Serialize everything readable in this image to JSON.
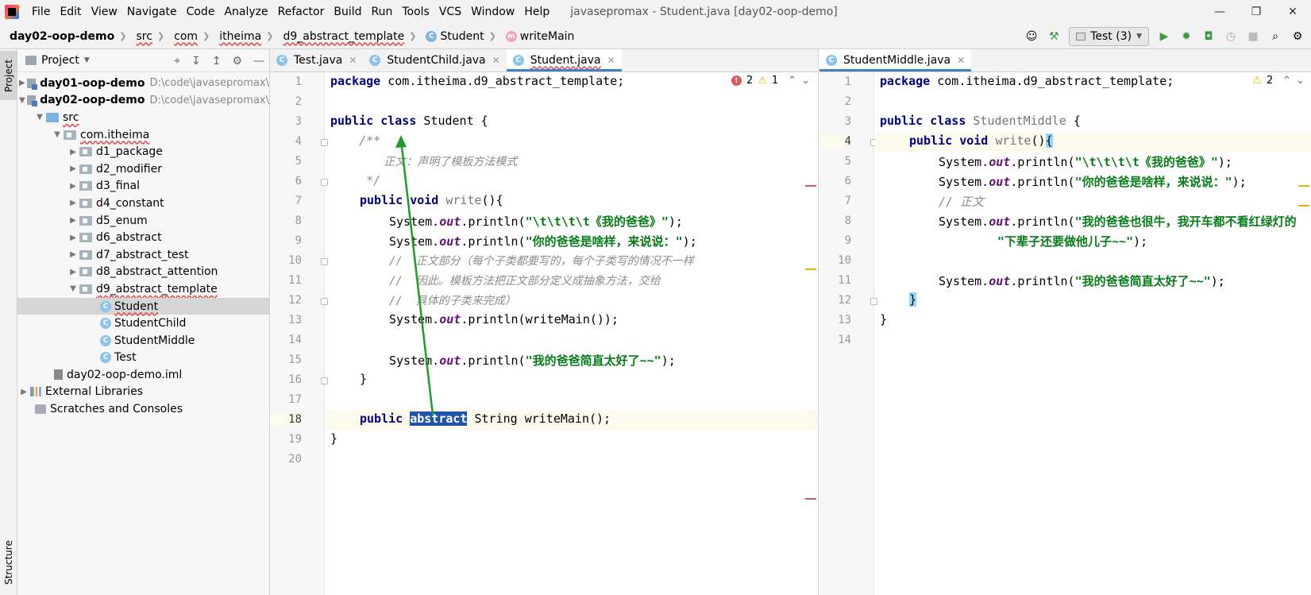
{
  "menubar": {
    "items": [
      "File",
      "Edit",
      "View",
      "Navigate",
      "Code",
      "Analyze",
      "Refactor",
      "Build",
      "Run",
      "Tools",
      "VCS",
      "Window",
      "Help"
    ],
    "title": "javasepromax - Student.java [day02-oop-demo]"
  },
  "navbar": {
    "crumbs": [
      "day02-oop-demo",
      "src",
      "com",
      "itheima",
      "d9_abstract_template",
      "Student",
      "writeMain"
    ],
    "run_config": "Test (3)"
  },
  "project_panel": {
    "title": "Project",
    "tree": [
      {
        "label": "day01-oop-demo",
        "hint": "D:\\code\\javasepromax\\"
      },
      {
        "label": "day02-oop-demo",
        "hint": "D:\\code\\javasepromax\\"
      },
      {
        "label": "src"
      },
      {
        "label": "com.itheima"
      },
      {
        "label": "d1_package"
      },
      {
        "label": "d2_modifier"
      },
      {
        "label": "d3_final"
      },
      {
        "label": "d4_constant"
      },
      {
        "label": "d5_enum"
      },
      {
        "label": "d6_abstract"
      },
      {
        "label": "d7_abstract_test"
      },
      {
        "label": "d8_abstract_attention"
      },
      {
        "label": "d9_abstract_template"
      },
      {
        "label": "Student"
      },
      {
        "label": "StudentChild"
      },
      {
        "label": "StudentMiddle"
      },
      {
        "label": "Test"
      },
      {
        "label": "day02-oop-demo.iml"
      },
      {
        "label": "External Libraries"
      },
      {
        "label": "Scratches and Consoles"
      }
    ]
  },
  "stripe": {
    "project": "Project",
    "structure": "Structure"
  },
  "editor_left": {
    "tabs": [
      "Test.java",
      "StudentChild.java",
      "Student.java"
    ],
    "inspection": {
      "errors": "2",
      "warnings": "1"
    },
    "lines": {
      "l1a": "package",
      "l1b": " com.itheima.d9_abstract_template;",
      "l3a": "public",
      "l3b": "class",
      "l3c": " Student {",
      "l4": "    /**",
      "l5": "        正文：声明了模板方法模式",
      "l6": "     */",
      "l7a": "public",
      "l7b": "void",
      "l7c": "write",
      "l8str": "\"\\t\\t\\t\\t《我的爸爸》\"",
      "l9str": "\"你的爸爸是啥样，来说说：\"",
      "l10": "//  正文部分（每个子类都要写的，每个子类写的情况不一样",
      "l11": "//  因此。模板方法把正文部分定义成抽象方法，交给",
      "l12": "//  具体的子类来完成）",
      "l15str": "\"我的爸爸简直太好了~~\"",
      "l18a": "public",
      "l18b": "abstract",
      "l18c": " String writeMain();"
    }
  },
  "editor_right": {
    "tabs": [
      "StudentMiddle.java"
    ],
    "inspection": {
      "warnings": "2"
    },
    "lines": {
      "l1a": "package",
      "l1b": " com.itheima.d9_abstract_template;",
      "l3a": "public",
      "l3b": "class",
      "l3c": "StudentMiddle",
      "l4a": "public",
      "l4b": "void",
      "l4c": "write",
      "l5str": "\"\\t\\t\\t\\t《我的爸爸》\"",
      "l6str": "\"你的爸爸是啥样，来说说：\"",
      "l7": "// 正文",
      "l8str": "\"我的爸爸也很牛，我开车都不看红绿灯的",
      "l9str": "\"下辈子还要做他儿子~~\"",
      "l11str": "\"我的爸爸简直太好了~~\""
    }
  },
  "colors": {
    "accent": "#4083c9",
    "annotation_arrow": "#1f9d2a",
    "selection": "#2154a8"
  }
}
